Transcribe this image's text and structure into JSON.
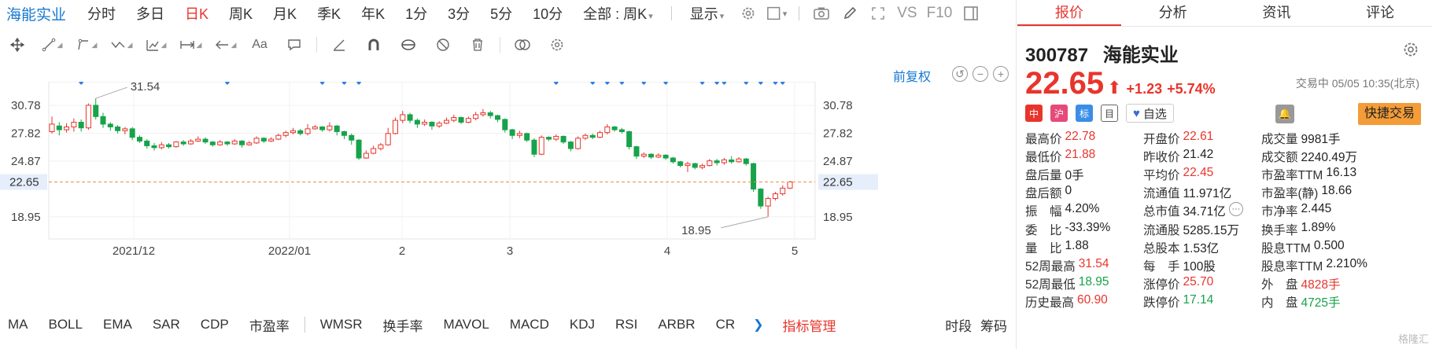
{
  "topbar": {
    "stock_name": "海能实业",
    "timeframes": [
      "分时",
      "多日",
      "日K",
      "周K",
      "月K",
      "季K",
      "年K",
      "1分",
      "3分",
      "5分",
      "10分"
    ],
    "active_timeframe": "日K",
    "range_select": "全部 : 周K",
    "display_label": "显示",
    "vs_label": "VS",
    "f10_label": "F10"
  },
  "toolbar": {
    "font_label": "Aa"
  },
  "chart": {
    "adjust_label": "前复权",
    "current_price": "22.65",
    "annotation_high": "31.54",
    "annotation_low": "18.95",
    "colors": {
      "up": "#e8352c",
      "down": "#17a34a",
      "marker": "#2f7fe5",
      "guide": "#f08a4b"
    },
    "x_axis_labels": [
      "2021/12",
      "2022/01",
      "2",
      "3",
      "4",
      "5"
    ]
  },
  "chart_data": {
    "type": "candlestick",
    "y_ticks": [
      30.78,
      27.82,
      24.87,
      18.95
    ],
    "ylim": [
      16.6,
      33.3
    ],
    "last_price": 22.65,
    "annotations": [
      {
        "label": "31.54"
      },
      {
        "label": "18.95"
      }
    ],
    "candles": [
      [
        28.0,
        28.8,
        27.8,
        29.6
      ],
      [
        28.6,
        28.2,
        27.6,
        29.0
      ],
      [
        28.2,
        28.5,
        27.9,
        28.9
      ],
      [
        28.5,
        29.0,
        28.0,
        29.4
      ],
      [
        29.0,
        28.4,
        28.0,
        29.3
      ],
      [
        28.4,
        30.8,
        28.2,
        31.0
      ],
      [
        30.8,
        29.6,
        29.3,
        31.54
      ],
      [
        29.6,
        28.8,
        28.4,
        30.0
      ],
      [
        28.8,
        28.5,
        28.1,
        29.0
      ],
      [
        28.5,
        28.1,
        27.8,
        28.7
      ],
      [
        28.1,
        28.3,
        27.7,
        28.5
      ],
      [
        28.3,
        27.4,
        27.1,
        28.5
      ],
      [
        27.4,
        27.0,
        26.8,
        27.6
      ],
      [
        27.0,
        26.5,
        26.2,
        27.2
      ],
      [
        26.5,
        26.3,
        26.0,
        26.8
      ],
      [
        26.3,
        26.6,
        26.1,
        26.9
      ],
      [
        26.6,
        26.4,
        26.2,
        26.8
      ],
      [
        26.4,
        26.9,
        26.3,
        27.0
      ],
      [
        26.9,
        26.7,
        26.5,
        27.1
      ],
      [
        26.7,
        27.0,
        26.6,
        27.2
      ],
      [
        27.0,
        27.2,
        26.9,
        27.5
      ],
      [
        27.2,
        26.9,
        26.7,
        27.4
      ],
      [
        26.9,
        26.6,
        26.4,
        27.0
      ],
      [
        26.6,
        26.9,
        26.5,
        27.1
      ],
      [
        26.9,
        26.7,
        26.5,
        27.0
      ],
      [
        26.7,
        27.0,
        26.6,
        27.2
      ],
      [
        27.0,
        26.6,
        26.3,
        27.1
      ],
      [
        26.6,
        26.8,
        26.5,
        27.0
      ],
      [
        26.8,
        27.3,
        26.7,
        27.5
      ],
      [
        27.3,
        27.0,
        26.8,
        27.4
      ],
      [
        27.0,
        27.2,
        26.9,
        27.4
      ],
      [
        27.2,
        27.6,
        27.1,
        27.8
      ],
      [
        27.6,
        27.9,
        27.4,
        28.1
      ],
      [
        27.9,
        28.1,
        27.7,
        28.4
      ],
      [
        28.1,
        27.8,
        27.6,
        28.3
      ],
      [
        27.8,
        28.3,
        27.6,
        28.8
      ],
      [
        28.3,
        28.5,
        28.2,
        28.7
      ],
      [
        28.5,
        28.2,
        28.0,
        28.6
      ],
      [
        28.2,
        28.6,
        28.0,
        29.0
      ],
      [
        28.6,
        28.0,
        27.6,
        28.7
      ],
      [
        28.0,
        27.6,
        27.2,
        28.1
      ],
      [
        27.6,
        27.1,
        26.6,
        27.8
      ],
      [
        27.1,
        25.2,
        25.0,
        27.2
      ],
      [
        25.2,
        25.7,
        25.1,
        26.0
      ],
      [
        25.7,
        26.2,
        25.6,
        26.5
      ],
      [
        26.2,
        26.6,
        26.0,
        26.8
      ],
      [
        26.6,
        27.8,
        26.5,
        28.4
      ],
      [
        27.8,
        29.2,
        27.7,
        29.5
      ],
      [
        29.2,
        29.8,
        28.9,
        30.2
      ],
      [
        29.8,
        29.2,
        28.9,
        30.0
      ],
      [
        29.2,
        28.8,
        28.4,
        29.4
      ],
      [
        28.8,
        29.0,
        28.6,
        29.3
      ],
      [
        29.0,
        28.6,
        28.2,
        29.1
      ],
      [
        28.6,
        28.9,
        28.4,
        29.1
      ],
      [
        28.9,
        29.2,
        28.8,
        29.5
      ],
      [
        29.2,
        29.5,
        29.0,
        29.8
      ],
      [
        29.5,
        29.0,
        28.8,
        29.6
      ],
      [
        29.0,
        29.4,
        28.9,
        29.6
      ],
      [
        29.4,
        29.8,
        29.2,
        30.1
      ],
      [
        29.8,
        30.0,
        29.6,
        30.4
      ],
      [
        30.0,
        29.7,
        29.4,
        30.2
      ],
      [
        29.7,
        29.3,
        29.0,
        29.8
      ],
      [
        29.3,
        28.2,
        27.9,
        29.4
      ],
      [
        28.2,
        27.6,
        27.2,
        28.3
      ],
      [
        27.6,
        27.8,
        27.3,
        28.1
      ],
      [
        27.8,
        27.1,
        26.9,
        27.9
      ],
      [
        27.1,
        25.6,
        25.3,
        27.3
      ],
      [
        25.6,
        27.4,
        25.5,
        27.6
      ],
      [
        27.4,
        27.2,
        27.0,
        27.5
      ],
      [
        27.2,
        27.5,
        27.0,
        27.7
      ],
      [
        27.5,
        26.9,
        26.7,
        27.6
      ],
      [
        26.9,
        26.2,
        25.9,
        27.0
      ],
      [
        26.2,
        27.3,
        26.1,
        27.5
      ],
      [
        27.3,
        27.6,
        27.1,
        27.8
      ],
      [
        27.6,
        27.4,
        27.2,
        27.8
      ],
      [
        27.4,
        27.9,
        27.3,
        28.1
      ],
      [
        27.9,
        28.5,
        27.7,
        28.8
      ],
      [
        28.5,
        28.2,
        28.0,
        28.6
      ],
      [
        28.2,
        28.0,
        27.8,
        28.4
      ],
      [
        28.0,
        26.4,
        26.1,
        28.1
      ],
      [
        26.4,
        25.4,
        25.1,
        26.5
      ],
      [
        25.4,
        25.6,
        25.2,
        25.8
      ],
      [
        25.6,
        25.3,
        25.1,
        25.7
      ],
      [
        25.3,
        25.5,
        25.2,
        25.7
      ],
      [
        25.5,
        25.2,
        25.0,
        25.6
      ],
      [
        25.2,
        24.8,
        24.6,
        25.3
      ],
      [
        24.8,
        24.4,
        24.2,
        24.9
      ],
      [
        24.4,
        24.6,
        23.7,
        24.8
      ],
      [
        24.6,
        24.2,
        24.0,
        24.7
      ],
      [
        24.2,
        24.4,
        24.0,
        24.6
      ],
      [
        24.4,
        24.9,
        24.3,
        25.1
      ],
      [
        24.9,
        24.7,
        24.4,
        25.1
      ],
      [
        24.7,
        25.0,
        24.5,
        25.2
      ],
      [
        25.0,
        24.8,
        24.6,
        25.4
      ],
      [
        24.8,
        25.1,
        24.7,
        25.3
      ],
      [
        25.1,
        24.6,
        24.4,
        25.2
      ],
      [
        24.6,
        21.9,
        21.6,
        24.7
      ],
      [
        21.9,
        20.1,
        19.8,
        22.0
      ],
      [
        20.1,
        20.9,
        18.95,
        21.1
      ],
      [
        20.9,
        21.4,
        20.7,
        21.6
      ],
      [
        21.4,
        22.0,
        21.2,
        22.3
      ],
      [
        22.0,
        22.65,
        21.9,
        22.78
      ]
    ]
  },
  "indicators": {
    "items": [
      "MA",
      "BOLL",
      "EMA",
      "SAR",
      "CDP",
      "市盈率",
      "WMSR",
      "换手率",
      "MAVOL",
      "MACD",
      "KDJ",
      "RSI",
      "ARBR",
      "CR"
    ],
    "manage_label": "指标管理",
    "right_items": [
      "时段",
      "筹码"
    ]
  },
  "quote": {
    "tabs": [
      "报价",
      "分析",
      "资讯",
      "评论"
    ],
    "active_tab": "报价",
    "code": "300787",
    "name": "海能实业",
    "price": "22.65",
    "change": "+1.23",
    "change_pct": "+5.74%",
    "status": "交易中 05/05 10:35(北京)",
    "watch_label": "自选",
    "fast_trade_label": "快捷交易",
    "badges": [
      "中",
      "沪",
      "标",
      "目"
    ],
    "rows": [
      [
        {
          "l": "最高价",
          "v": "22.78",
          "c": "up"
        },
        {
          "l": "开盘价",
          "v": "22.61",
          "c": "up"
        },
        {
          "l": "成交量",
          "v": "9981手",
          "c": ""
        }
      ],
      [
        {
          "l": "最低价",
          "v": "21.88",
          "c": "up"
        },
        {
          "l": "昨收价",
          "v": "21.42",
          "c": ""
        },
        {
          "l": "成交额",
          "v": "2240.49万",
          "c": ""
        }
      ],
      [
        {
          "l": "盘后量",
          "v": "0手",
          "c": ""
        },
        {
          "l": "平均价",
          "v": "22.45",
          "c": "up"
        },
        {
          "l": "市盈率TTM",
          "v": "16.13",
          "c": ""
        }
      ],
      [
        {
          "l": "盘后额",
          "v": "0",
          "c": ""
        },
        {
          "l": "流通值",
          "v": "11.971亿",
          "c": ""
        },
        {
          "l": "市盈率(静)",
          "v": "18.66",
          "c": ""
        }
      ],
      [
        {
          "l": "振　幅",
          "v": "4.20%",
          "c": ""
        },
        {
          "l": "总市值",
          "v": "34.71亿",
          "c": ""
        },
        {
          "l": "市净率",
          "v": "2.445",
          "c": ""
        }
      ],
      [
        {
          "l": "委　比",
          "v": "-33.39%",
          "c": ""
        },
        {
          "l": "流通股",
          "v": "5285.15万",
          "c": ""
        },
        {
          "l": "换手率",
          "v": "1.89%",
          "c": ""
        }
      ],
      [
        {
          "l": "量　比",
          "v": "1.88",
          "c": ""
        },
        {
          "l": "总股本",
          "v": "1.53亿",
          "c": ""
        },
        {
          "l": "股息TTM",
          "v": "0.500",
          "c": ""
        }
      ],
      [
        {
          "l": "52周最高",
          "v": "31.54",
          "c": "up"
        },
        {
          "l": "每　手",
          "v": "100股",
          "c": ""
        },
        {
          "l": "股息率TTM",
          "v": "2.210%",
          "c": ""
        }
      ],
      [
        {
          "l": "52周最低",
          "v": "18.95",
          "c": "dn"
        },
        {
          "l": "涨停价",
          "v": "25.70",
          "c": "up"
        },
        {
          "l": "外　盘",
          "v": "4828手",
          "c": "up"
        }
      ],
      [
        {
          "l": "历史最高",
          "v": "60.90",
          "c": "up"
        },
        {
          "l": "跌停价",
          "v": "17.14",
          "c": "dn"
        },
        {
          "l": "内　盘",
          "v": "4725手",
          "c": "dn"
        }
      ]
    ]
  }
}
